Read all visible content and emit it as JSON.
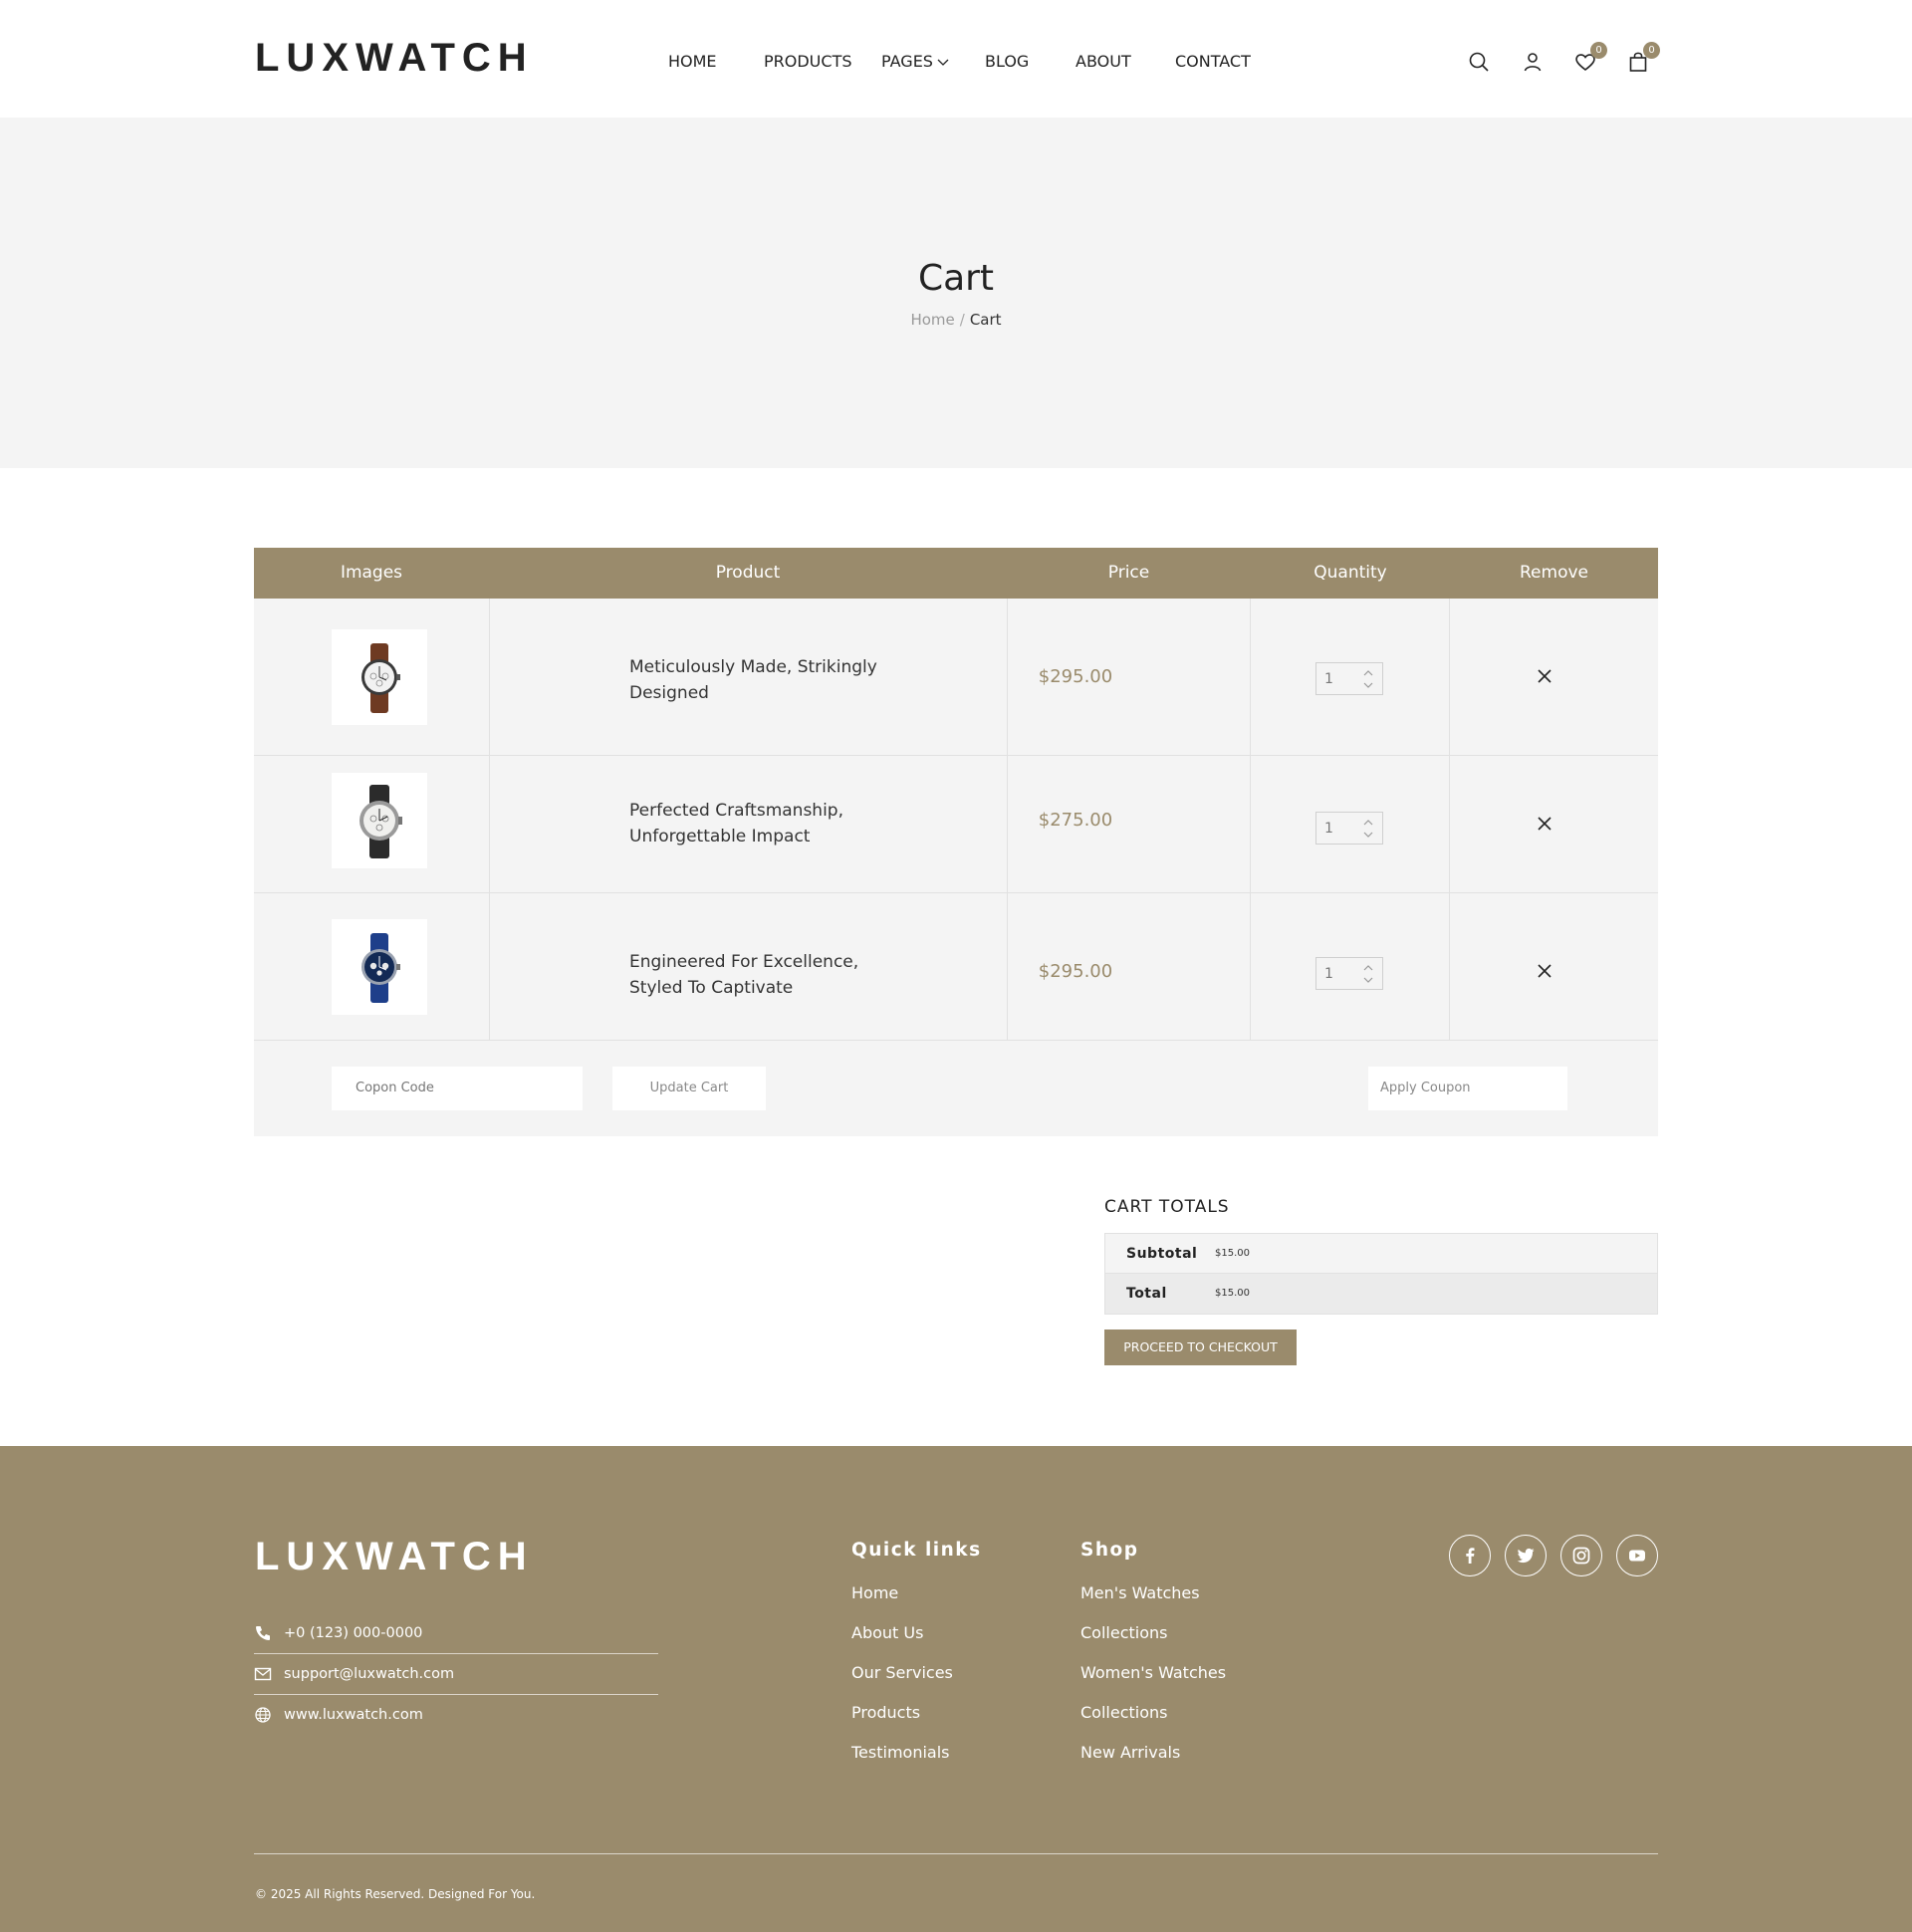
{
  "brand": {
    "logo": "LUXWATCH",
    "accent": "#9a8b6c",
    "hero_bg": "#f4f4f4"
  },
  "nav": {
    "items": [
      {
        "label": "HOME"
      },
      {
        "label": "PRODUCTS"
      },
      {
        "label": "PAGES"
      },
      {
        "label": "BLOG"
      },
      {
        "label": "ABOUT"
      },
      {
        "label": "CONTACT"
      }
    ]
  },
  "header_icons": {
    "search": "search-icon",
    "account": "user-icon",
    "wishlist": {
      "icon": "heart-icon",
      "count": "0"
    },
    "cart": {
      "icon": "shopping-bag-icon",
      "count": "0"
    }
  },
  "hero": {
    "title": "Cart",
    "breadcrumb": {
      "home": "Home",
      "separator": "/",
      "current": "Cart"
    }
  },
  "cart_table": {
    "headers": [
      "Images",
      "Product",
      "Price",
      "Quantity",
      "Remove"
    ],
    "rows": [
      {
        "image": "watch-brown-strap",
        "name": "Meticulously Made, Strikingly Designed",
        "price": "$295.00",
        "quantity": "1"
      },
      {
        "image": "watch-steel-black-strap",
        "name": "Perfected Craftsmanship, Unforgettable Impact",
        "price": "$275.00",
        "quantity": "1"
      },
      {
        "image": "watch-blue-strap",
        "name": "Engineered For Excellence, Styled To Captivate",
        "price": "$295.00",
        "quantity": "1"
      }
    ],
    "coupon_placeholder": "Copon Code",
    "update_label": "Update Cart",
    "apply_label": "Apply Coupon"
  },
  "totals": {
    "title": "CART TOTALS",
    "subtotal_label": "Subtotal",
    "subtotal_value": "$15.00",
    "total_label": "Total",
    "total_value": "$15.00",
    "checkout_label": "PROCEED TO CHECKOUT"
  },
  "footer": {
    "logo": "LUXWATCH",
    "contact": {
      "phone": "+0 (123) 000-0000",
      "email": "support@luxwatch.com",
      "website": "www.luxwatch.com"
    },
    "quick_links": {
      "title": "Quick links",
      "items": [
        "Home",
        "About Us",
        "Our Services",
        "Products",
        "Testimonials"
      ]
    },
    "shop": {
      "title": "Shop",
      "items": [
        "Men's Watches",
        "Collections",
        "Women's Watches",
        "Collections",
        "New Arrivals"
      ]
    },
    "socials": [
      "facebook-icon",
      "twitter-icon",
      "instagram-icon",
      "youtube-icon"
    ],
    "copyright": "© 2025 All Rights Reserved. Designed For You."
  }
}
